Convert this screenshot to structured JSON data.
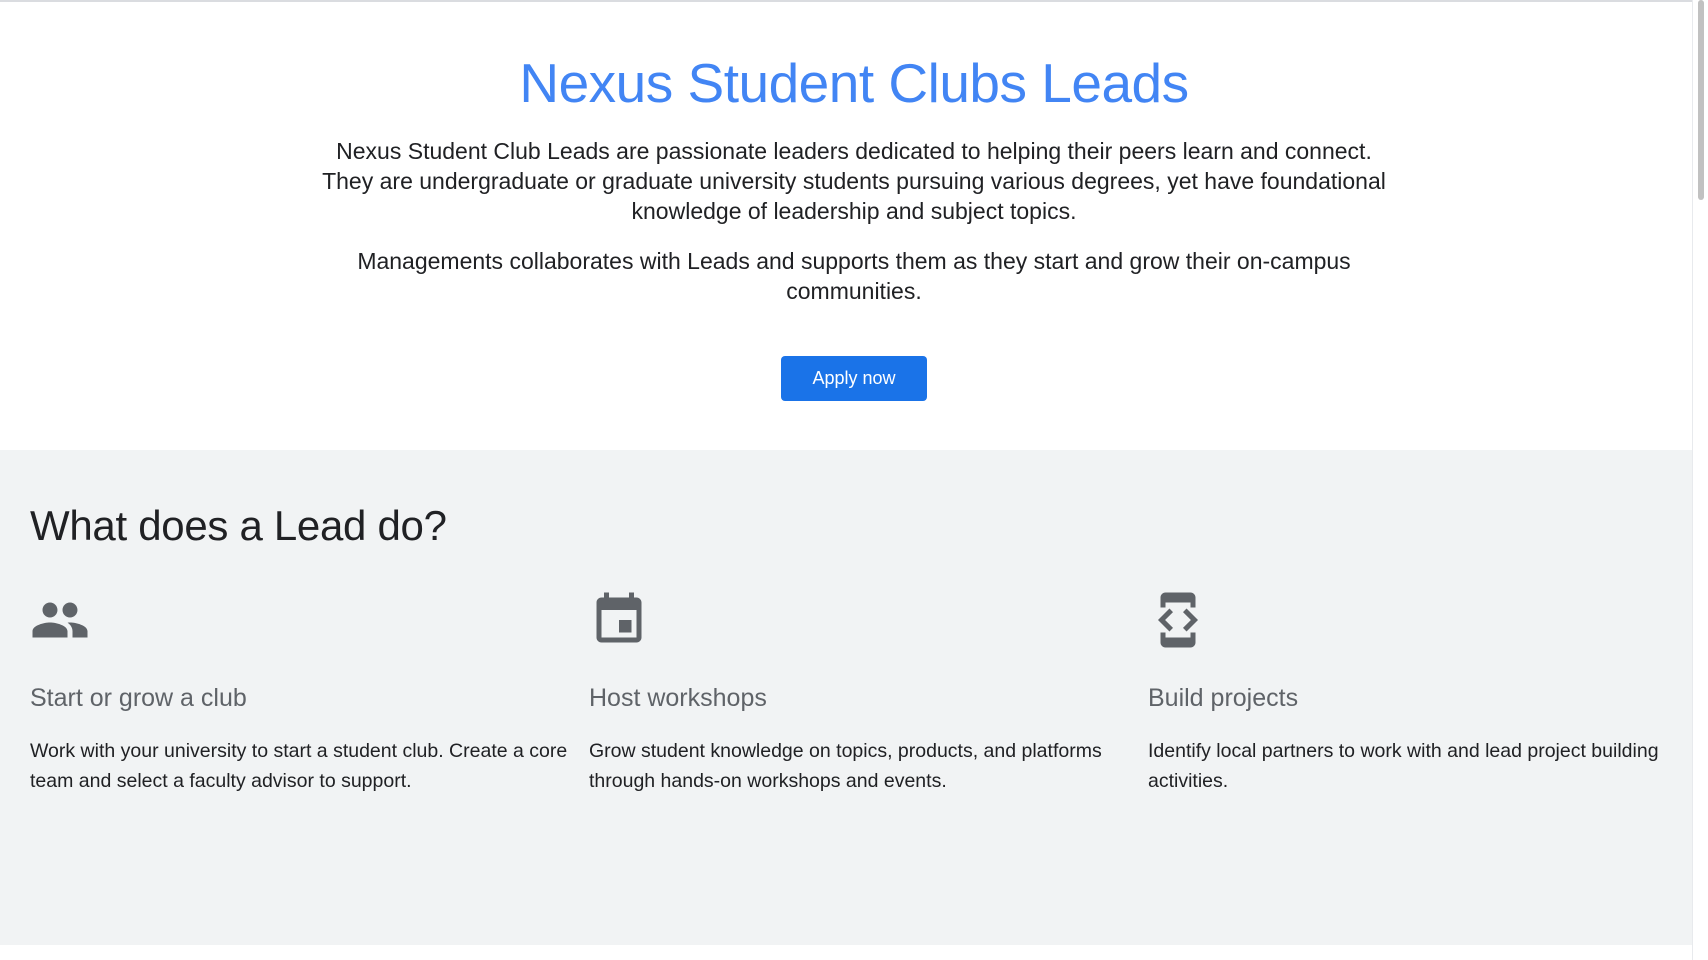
{
  "hero": {
    "title": "Nexus Student Clubs Leads",
    "description_1": "Nexus Student Club Leads are passionate leaders dedicated to helping their peers learn and connect. They are undergraduate or graduate university students pursuing various degrees, yet have foundational knowledge of leadership and subject topics.",
    "description_2": "Managements collaborates with Leads and supports them as they start and grow their on-campus communities.",
    "apply_label": "Apply now"
  },
  "features": {
    "title": "What does a Lead do?",
    "items": [
      {
        "icon": "people-icon",
        "title": "Start or grow a club",
        "text": "Work with your university to start a student club. Create a core team and select a faculty advisor to support."
      },
      {
        "icon": "calendar-icon",
        "title": "Host workshops",
        "text": "Grow student knowledge on topics, products, and platforms through hands-on workshops and events."
      },
      {
        "icon": "developer-mode-icon",
        "title": "Build projects",
        "text": "Identify local partners to work with and lead project building activities."
      }
    ]
  },
  "colors": {
    "accent_title": "#4285f4",
    "button": "#1a73e8",
    "section_bg": "#f1f3f4",
    "icon": "#5f6368"
  }
}
